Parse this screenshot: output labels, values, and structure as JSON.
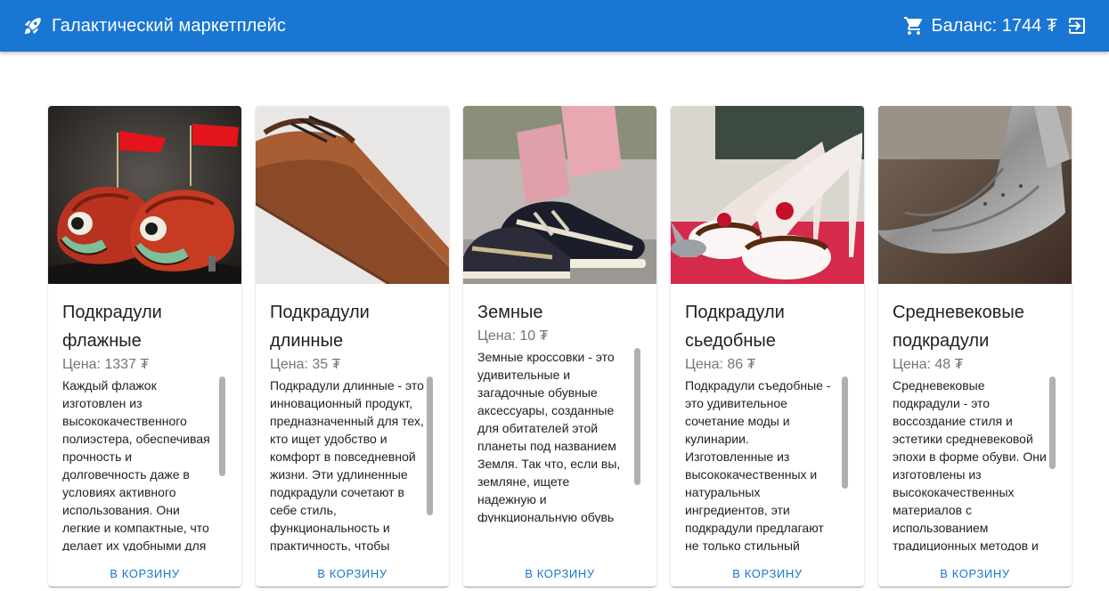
{
  "header": {
    "title": "Галактический маркетплейс",
    "balance": "Баланс: 1744 ₮",
    "icons": {
      "logo": "rocket-icon",
      "cart": "cart-icon",
      "logout": "logout-icon"
    },
    "color": "#1976d2"
  },
  "products": [
    {
      "name": "Подкрадули флажные",
      "price": "Цена: 1337 ₮",
      "description": "Каждый флажок изготовлен из высококачественного полиэстера, обеспечивая прочность и долговечность даже в условиях активного использования. Они легкие и компактные, что делает их удобными для",
      "button": "В корзину"
    },
    {
      "name": "Подкрадули длинные",
      "price": "Цена: 35 ₮",
      "description": "Подкрадули длинные - это инновационный продукт, предназначенный для тех, кто ищет удобство и комфорт в повседневной жизни. Эти удлиненные подкрадули сочетают в себе стиль, функциональность и практичность, чтобы",
      "button": "В корзину"
    },
    {
      "name": "Земные",
      "price": "Цена: 10 ₮",
      "description": "Земные кроссовки - это удивительные и загадочные обувные аксессуары, созданные для обитателей этой планеты под названием Земля. Так что, если вы, земляне, ищете надежную и функциональную обувь для своих приключений",
      "button": "В корзину"
    },
    {
      "name": "Подкрадули сьедобные",
      "price": "Цена: 86 ₮",
      "description": "Подкрадули съедобные - это удивительное сочетание моды и кулинарии. Изготовленные из высококачественных и натуральных ингредиентов, эти подкрадули предлагают не только стильный",
      "button": "В корзину"
    },
    {
      "name": "Средневековые подкрадули",
      "price": "Цена: 48 ₮",
      "description": "Средневековые подкрадули - это воссоздание стиля и эстетики средневековой эпохи в форме обуви. Они изготовлены из высококачественных материалов с использованием традиционных методов и",
      "button": "В корзину"
    }
  ]
}
